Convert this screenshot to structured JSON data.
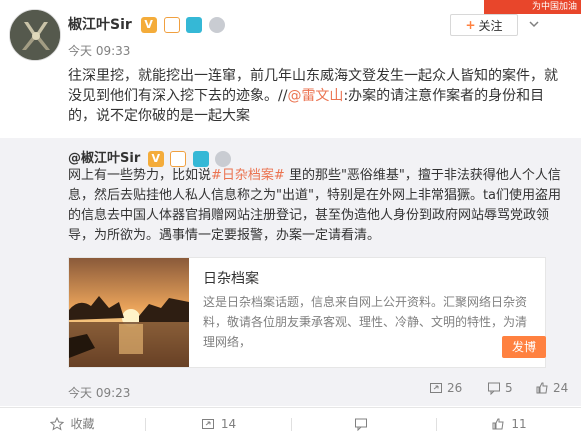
{
  "corner_banner": {
    "text": "为中国加油"
  },
  "post": {
    "author": "椒江叶Sir",
    "time": "今天 09:33",
    "follow_label": "关注",
    "text_prefix": "往深里挖，就能挖出一连窜，前几年山东威海文登发生一起众人皆知的案件，就没见到他们有深入挖下去的迹象。//",
    "mention": "@雷文山",
    "text_suffix": ":办案的请注意作案者的身份和目的，说不定你破的是一起大案"
  },
  "repost": {
    "author": "@椒江叶Sir",
    "text_prefix": "网上有一些势力，比如说",
    "hashtag": "#日杂档案#",
    "text_suffix": " 里的那些\"恶俗维基\"，擅于非法获得他人个人信息，然后去贴挂他人私人信息称之为\"出道\"，特别是在外网上非常猖獗。ta们使用盗用的信息去中国人体器官捐赠网站注册登记，甚至伪造他人身份到政府网站辱骂党政领导，为所欲为。遇事情一定要报警，办案一定请看清。",
    "time": "今天 09:23",
    "stats": {
      "reposts": "26",
      "comments": "5",
      "likes": "24"
    },
    "card": {
      "title": "日杂档案",
      "description": "这是日杂档案话题，信息来自网上公开资料。汇聚网络日杂资料，敬请各位朋友秉承客观、理性、冷静、文明的特性，为清理网络，",
      "cta": "发博"
    }
  },
  "actions": {
    "favorite": "收藏",
    "repost": "14",
    "comment": "",
    "like": "11"
  },
  "colors": {
    "link": "#eb7350",
    "cta": "#ff8140",
    "banner": "#e8462b",
    "repost_bg": "#f2f2f5"
  }
}
